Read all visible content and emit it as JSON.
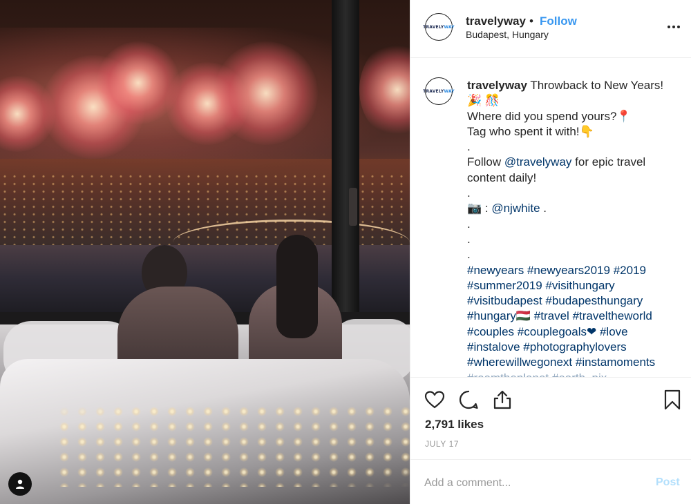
{
  "post": {
    "username": "travelyway",
    "follow_label": "Follow",
    "separator": "•",
    "location": "Budapest, Hungary",
    "avatar_text_a": "TRAVELY",
    "avatar_text_b": "WAY"
  },
  "caption": {
    "username": "travelyway",
    "line1": " Throwback to New Years! 🎉 🎊",
    "line2": "Where did you spend yours?📍",
    "line3": "Tag who spent it with!👇",
    "dot1": ".",
    "follow_pre": "Follow ",
    "follow_handle": "@travelyway",
    "follow_post": " for epic travel content daily!",
    "dot2": ".",
    "camera": "📷 : ",
    "credit_handle": "@njwhite",
    "credit_post": " .",
    "dot3": ".",
    "dot4": ".",
    "dot5": ".",
    "hashtags": [
      "#newyears",
      "#newyears2019",
      "#2019",
      "#summer2019",
      "#visithungary",
      "#visitbudapest",
      "#budapesthungary",
      "#hungary🇭🇺",
      "#travel",
      "#traveltheworld",
      "#couples",
      "#couplegoals❤",
      "#love",
      "#instalove",
      "#photographylovers",
      "#wherewillwegonext",
      "#instamoments"
    ],
    "cut_line": "#roamtheplanet #earth_pix"
  },
  "actions": {
    "likes": "2,791 likes",
    "date": "JULY 17",
    "comment_placeholder": "Add a comment...",
    "post_label": "Post"
  },
  "icons": {
    "like": "heart-icon",
    "comment": "comment-icon",
    "share": "share-icon",
    "save": "bookmark-icon",
    "more": "more-options-icon",
    "tagged": "user-tag-icon"
  },
  "colors": {
    "link": "#003569",
    "follow": "#3897f0",
    "post_disabled": "#b2dffc",
    "muted": "#999999"
  }
}
